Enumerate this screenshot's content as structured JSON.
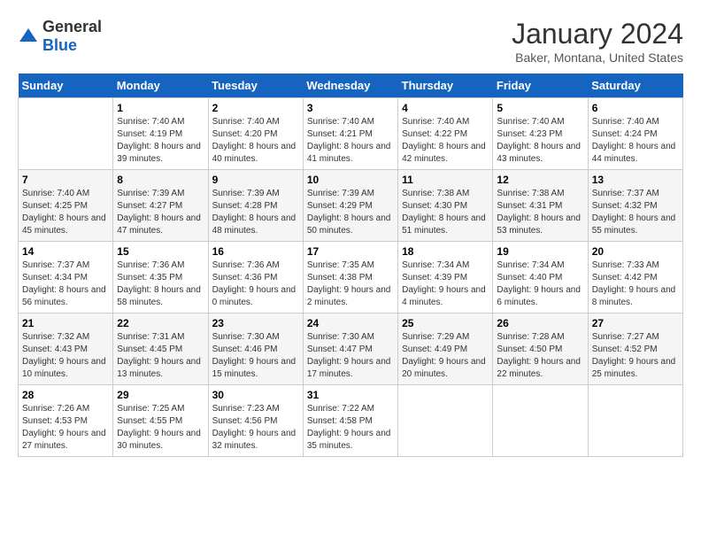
{
  "logo": {
    "text_general": "General",
    "text_blue": "Blue"
  },
  "title": {
    "month": "January 2024",
    "location": "Baker, Montana, United States"
  },
  "headers": [
    "Sunday",
    "Monday",
    "Tuesday",
    "Wednesday",
    "Thursday",
    "Friday",
    "Saturday"
  ],
  "weeks": [
    [
      {
        "day": "",
        "sunrise": "",
        "sunset": "",
        "daylight": ""
      },
      {
        "day": "1",
        "sunrise": "Sunrise: 7:40 AM",
        "sunset": "Sunset: 4:19 PM",
        "daylight": "Daylight: 8 hours and 39 minutes."
      },
      {
        "day": "2",
        "sunrise": "Sunrise: 7:40 AM",
        "sunset": "Sunset: 4:20 PM",
        "daylight": "Daylight: 8 hours and 40 minutes."
      },
      {
        "day": "3",
        "sunrise": "Sunrise: 7:40 AM",
        "sunset": "Sunset: 4:21 PM",
        "daylight": "Daylight: 8 hours and 41 minutes."
      },
      {
        "day": "4",
        "sunrise": "Sunrise: 7:40 AM",
        "sunset": "Sunset: 4:22 PM",
        "daylight": "Daylight: 8 hours and 42 minutes."
      },
      {
        "day": "5",
        "sunrise": "Sunrise: 7:40 AM",
        "sunset": "Sunset: 4:23 PM",
        "daylight": "Daylight: 8 hours and 43 minutes."
      },
      {
        "day": "6",
        "sunrise": "Sunrise: 7:40 AM",
        "sunset": "Sunset: 4:24 PM",
        "daylight": "Daylight: 8 hours and 44 minutes."
      }
    ],
    [
      {
        "day": "7",
        "sunrise": "Sunrise: 7:40 AM",
        "sunset": "Sunset: 4:25 PM",
        "daylight": "Daylight: 8 hours and 45 minutes."
      },
      {
        "day": "8",
        "sunrise": "Sunrise: 7:39 AM",
        "sunset": "Sunset: 4:27 PM",
        "daylight": "Daylight: 8 hours and 47 minutes."
      },
      {
        "day": "9",
        "sunrise": "Sunrise: 7:39 AM",
        "sunset": "Sunset: 4:28 PM",
        "daylight": "Daylight: 8 hours and 48 minutes."
      },
      {
        "day": "10",
        "sunrise": "Sunrise: 7:39 AM",
        "sunset": "Sunset: 4:29 PM",
        "daylight": "Daylight: 8 hours and 50 minutes."
      },
      {
        "day": "11",
        "sunrise": "Sunrise: 7:38 AM",
        "sunset": "Sunset: 4:30 PM",
        "daylight": "Daylight: 8 hours and 51 minutes."
      },
      {
        "day": "12",
        "sunrise": "Sunrise: 7:38 AM",
        "sunset": "Sunset: 4:31 PM",
        "daylight": "Daylight: 8 hours and 53 minutes."
      },
      {
        "day": "13",
        "sunrise": "Sunrise: 7:37 AM",
        "sunset": "Sunset: 4:32 PM",
        "daylight": "Daylight: 8 hours and 55 minutes."
      }
    ],
    [
      {
        "day": "14",
        "sunrise": "Sunrise: 7:37 AM",
        "sunset": "Sunset: 4:34 PM",
        "daylight": "Daylight: 8 hours and 56 minutes."
      },
      {
        "day": "15",
        "sunrise": "Sunrise: 7:36 AM",
        "sunset": "Sunset: 4:35 PM",
        "daylight": "Daylight: 8 hours and 58 minutes."
      },
      {
        "day": "16",
        "sunrise": "Sunrise: 7:36 AM",
        "sunset": "Sunset: 4:36 PM",
        "daylight": "Daylight: 9 hours and 0 minutes."
      },
      {
        "day": "17",
        "sunrise": "Sunrise: 7:35 AM",
        "sunset": "Sunset: 4:38 PM",
        "daylight": "Daylight: 9 hours and 2 minutes."
      },
      {
        "day": "18",
        "sunrise": "Sunrise: 7:34 AM",
        "sunset": "Sunset: 4:39 PM",
        "daylight": "Daylight: 9 hours and 4 minutes."
      },
      {
        "day": "19",
        "sunrise": "Sunrise: 7:34 AM",
        "sunset": "Sunset: 4:40 PM",
        "daylight": "Daylight: 9 hours and 6 minutes."
      },
      {
        "day": "20",
        "sunrise": "Sunrise: 7:33 AM",
        "sunset": "Sunset: 4:42 PM",
        "daylight": "Daylight: 9 hours and 8 minutes."
      }
    ],
    [
      {
        "day": "21",
        "sunrise": "Sunrise: 7:32 AM",
        "sunset": "Sunset: 4:43 PM",
        "daylight": "Daylight: 9 hours and 10 minutes."
      },
      {
        "day": "22",
        "sunrise": "Sunrise: 7:31 AM",
        "sunset": "Sunset: 4:45 PM",
        "daylight": "Daylight: 9 hours and 13 minutes."
      },
      {
        "day": "23",
        "sunrise": "Sunrise: 7:30 AM",
        "sunset": "Sunset: 4:46 PM",
        "daylight": "Daylight: 9 hours and 15 minutes."
      },
      {
        "day": "24",
        "sunrise": "Sunrise: 7:30 AM",
        "sunset": "Sunset: 4:47 PM",
        "daylight": "Daylight: 9 hours and 17 minutes."
      },
      {
        "day": "25",
        "sunrise": "Sunrise: 7:29 AM",
        "sunset": "Sunset: 4:49 PM",
        "daylight": "Daylight: 9 hours and 20 minutes."
      },
      {
        "day": "26",
        "sunrise": "Sunrise: 7:28 AM",
        "sunset": "Sunset: 4:50 PM",
        "daylight": "Daylight: 9 hours and 22 minutes."
      },
      {
        "day": "27",
        "sunrise": "Sunrise: 7:27 AM",
        "sunset": "Sunset: 4:52 PM",
        "daylight": "Daylight: 9 hours and 25 minutes."
      }
    ],
    [
      {
        "day": "28",
        "sunrise": "Sunrise: 7:26 AM",
        "sunset": "Sunset: 4:53 PM",
        "daylight": "Daylight: 9 hours and 27 minutes."
      },
      {
        "day": "29",
        "sunrise": "Sunrise: 7:25 AM",
        "sunset": "Sunset: 4:55 PM",
        "daylight": "Daylight: 9 hours and 30 minutes."
      },
      {
        "day": "30",
        "sunrise": "Sunrise: 7:23 AM",
        "sunset": "Sunset: 4:56 PM",
        "daylight": "Daylight: 9 hours and 32 minutes."
      },
      {
        "day": "31",
        "sunrise": "Sunrise: 7:22 AM",
        "sunset": "Sunset: 4:58 PM",
        "daylight": "Daylight: 9 hours and 35 minutes."
      },
      {
        "day": "",
        "sunrise": "",
        "sunset": "",
        "daylight": ""
      },
      {
        "day": "",
        "sunrise": "",
        "sunset": "",
        "daylight": ""
      },
      {
        "day": "",
        "sunrise": "",
        "sunset": "",
        "daylight": ""
      }
    ]
  ]
}
